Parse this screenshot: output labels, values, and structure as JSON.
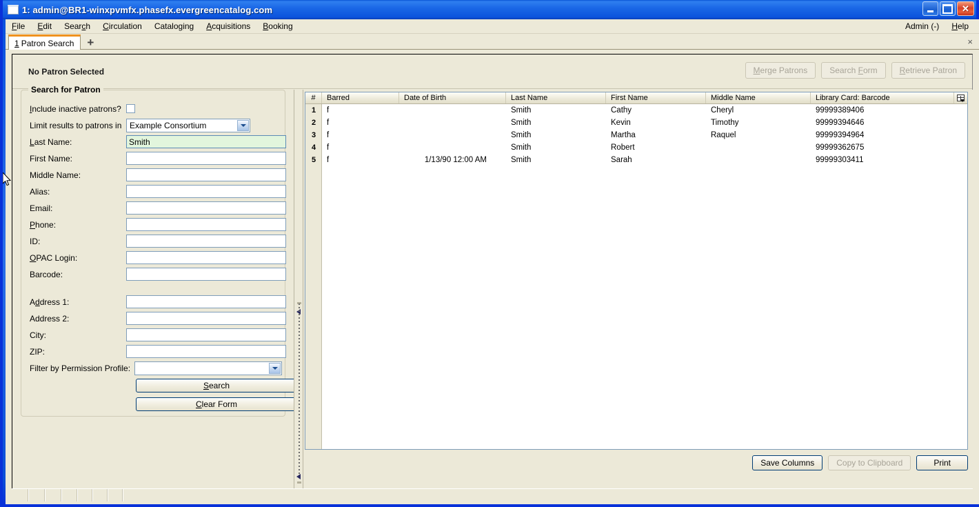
{
  "window": {
    "title": "1: admin@BR1-winxpvmfx.phasefx.evergreencatalog.com",
    "icon": "window-icon",
    "minimize_label": "Minimize",
    "maximize_label": "Maximize",
    "close_label": "Close"
  },
  "menubar": {
    "items": [
      {
        "label": "File",
        "accel": "F"
      },
      {
        "label": "Edit",
        "accel": "E"
      },
      {
        "label": "Search",
        "accel": "c"
      },
      {
        "label": "Circulation",
        "accel": "C"
      },
      {
        "label": "Cataloging",
        "accel": "g"
      },
      {
        "label": "Acquisitions",
        "accel": "A"
      },
      {
        "label": "Booking",
        "accel": "B"
      }
    ],
    "right_items": [
      {
        "label": "Admin (-)"
      },
      {
        "label": "Help",
        "accel": "H"
      }
    ]
  },
  "tabs": {
    "items": [
      {
        "number": "1",
        "label": "Patron Search",
        "active": true
      }
    ],
    "new_tab_label": "+",
    "close_all_label": "×"
  },
  "patron_bar": {
    "status": "No Patron Selected",
    "buttons": [
      {
        "label": "Merge Patrons",
        "name": "merge-patrons-button",
        "disabled": true
      },
      {
        "label": "Search Form",
        "name": "search-form-button",
        "disabled": true
      },
      {
        "label": "Retrieve Patron",
        "name": "retrieve-patron-button",
        "disabled": true
      }
    ]
  },
  "search_form": {
    "legend": "Search for Patron",
    "fields": [
      {
        "label": "Include inactive patrons?",
        "type": "checkbox",
        "name": "include-inactive-patrons-checkbox",
        "checked": false,
        "value": ""
      },
      {
        "label": "Limit results to patrons in",
        "type": "select",
        "name": "limit-results-select",
        "value": "Example Consortium"
      },
      {
        "label": "Last Name:",
        "type": "text",
        "name": "last-name-input",
        "value": "Smith",
        "focused": true
      },
      {
        "label": "First Name:",
        "type": "text",
        "name": "first-name-input",
        "value": ""
      },
      {
        "label": "Middle Name:",
        "type": "text",
        "name": "middle-name-input",
        "value": ""
      },
      {
        "label": "Alias:",
        "type": "text",
        "name": "alias-input",
        "value": ""
      },
      {
        "label": "Email:",
        "type": "text",
        "name": "email-input",
        "value": ""
      },
      {
        "label": "Phone:",
        "type": "text",
        "name": "phone-input",
        "value": ""
      },
      {
        "label": "ID:",
        "type": "text",
        "name": "id-input",
        "value": ""
      },
      {
        "label": "OPAC Login:",
        "type": "text",
        "name": "opac-login-input",
        "value": ""
      },
      {
        "label": "Barcode:",
        "type": "text",
        "name": "barcode-input",
        "value": ""
      },
      {
        "label": "Address 1:",
        "type": "text",
        "name": "address1-input",
        "value": ""
      },
      {
        "label": "Address 2:",
        "type": "text",
        "name": "address2-input",
        "value": ""
      },
      {
        "label": "City:",
        "type": "text",
        "name": "city-input",
        "value": ""
      },
      {
        "label": "ZIP:",
        "type": "text",
        "name": "zip-input",
        "value": ""
      },
      {
        "label": "Filter by Permission Profile:",
        "type": "select",
        "name": "permission-profile-select",
        "value": ""
      }
    ],
    "search_button": "Search",
    "clear_button": "Clear Form"
  },
  "results": {
    "columns": [
      "#",
      "Barred",
      "Date of Birth",
      "Last Name",
      "First Name",
      "Middle Name",
      "Library Card: Barcode"
    ],
    "column_picker_label": "Column Picker",
    "rows": [
      {
        "num": "1",
        "barred": "f",
        "dob": "",
        "last": "Smith",
        "first": "Cathy",
        "middle": "Cheryl",
        "barcode": "99999389406"
      },
      {
        "num": "2",
        "barred": "f",
        "dob": "",
        "last": "Smith",
        "first": "Kevin",
        "middle": "Timothy",
        "barcode": "99999394646"
      },
      {
        "num": "3",
        "barred": "f",
        "dob": "",
        "last": "Smith",
        "first": "Martha",
        "middle": "Raquel",
        "barcode": "99999394964"
      },
      {
        "num": "4",
        "barred": "f",
        "dob": "",
        "last": "Smith",
        "first": "Robert",
        "middle": "",
        "barcode": "99999362675"
      },
      {
        "num": "5",
        "barred": "f",
        "dob": "1/13/90 12:00 AM",
        "last": "Smith",
        "first": "Sarah",
        "middle": "",
        "barcode": "99999303411"
      }
    ],
    "footer_buttons": [
      {
        "label": "Save Columns",
        "name": "save-columns-button",
        "disabled": false
      },
      {
        "label": "Copy to Clipboard",
        "name": "copy-to-clipboard-button",
        "disabled": true
      },
      {
        "label": "Print",
        "name": "print-button",
        "disabled": false
      }
    ]
  },
  "colors": {
    "titlebar_blue": "#0a56d6",
    "window_chrome": "#ece9d8",
    "active_tab_accent": "#f0921e",
    "focused_field_bg": "#e2f5dd",
    "field_border": "#7f9db9",
    "button_border": "#003c74"
  }
}
